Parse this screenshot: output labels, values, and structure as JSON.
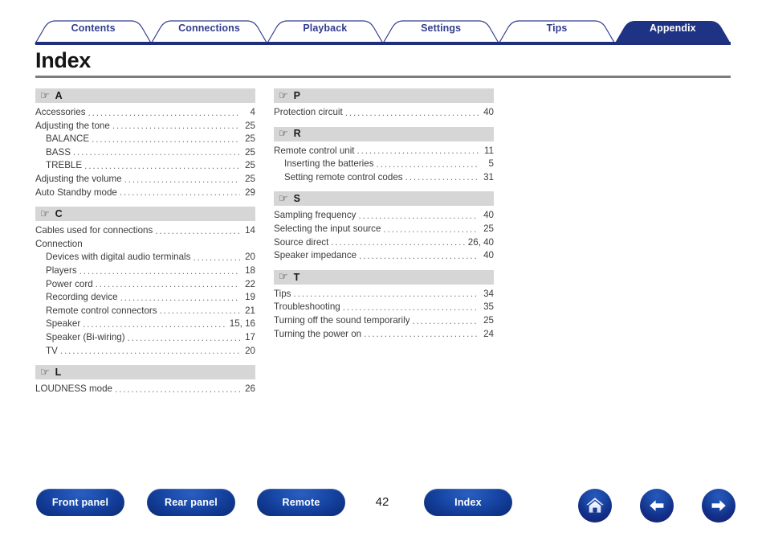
{
  "tabs": [
    {
      "label": "Contents",
      "active": false
    },
    {
      "label": "Connections",
      "active": false
    },
    {
      "label": "Playback",
      "active": false
    },
    {
      "label": "Settings",
      "active": false
    },
    {
      "label": "Tips",
      "active": false
    },
    {
      "label": "Appendix",
      "active": true
    }
  ],
  "page": {
    "title": "Index",
    "number": "42"
  },
  "colors": {
    "tab_border": "#313e8f",
    "tab_active_fill": "#1f3384",
    "tab_text": "#313e8f",
    "tab_active_text": "#ffffff",
    "rule_navy": "#1f2f7a",
    "rule_gray": "#7c7c7c",
    "section_band": "#d6d6d6",
    "entry_text": "#3c3c3c",
    "button_blue": "#14409b"
  },
  "section_icon": "pointing-hand-icon",
  "columns": {
    "left": [
      {
        "letter": "A",
        "entries": [
          {
            "text": "Accessories",
            "page": "4",
            "level": 0,
            "leader": true
          },
          {
            "text": "Adjusting the tone",
            "page": "25",
            "level": 0,
            "leader": true
          },
          {
            "text": "BALANCE",
            "page": "25",
            "level": 1,
            "leader": true
          },
          {
            "text": "BASS",
            "page": "25",
            "level": 1,
            "leader": true
          },
          {
            "text": "TREBLE",
            "page": "25",
            "level": 1,
            "leader": true
          },
          {
            "text": "Adjusting the volume",
            "page": "25",
            "level": 0,
            "leader": true
          },
          {
            "text": "Auto Standby mode",
            "page": "29",
            "level": 0,
            "leader": true
          }
        ]
      },
      {
        "letter": "C",
        "entries": [
          {
            "text": "Cables used for connections",
            "page": "14",
            "level": 0,
            "leader": true
          },
          {
            "text": "Connection",
            "page": "",
            "level": 0,
            "leader": false
          },
          {
            "text": "Devices with digital audio terminals",
            "page": "20",
            "level": 1,
            "leader": true
          },
          {
            "text": "Players",
            "page": "18",
            "level": 1,
            "leader": true
          },
          {
            "text": "Power cord",
            "page": "22",
            "level": 1,
            "leader": true
          },
          {
            "text": "Recording device",
            "page": "19",
            "level": 1,
            "leader": true
          },
          {
            "text": "Remote control connectors",
            "page": "21",
            "level": 1,
            "leader": true
          },
          {
            "text": "Speaker",
            "page": "15, 16",
            "level": 1,
            "leader": true
          },
          {
            "text": "Speaker (Bi-wiring)",
            "page": "17",
            "level": 1,
            "leader": true
          },
          {
            "text": "TV",
            "page": "20",
            "level": 1,
            "leader": true
          }
        ]
      },
      {
        "letter": "L",
        "entries": [
          {
            "text": "LOUDNESS mode",
            "page": "26",
            "level": 0,
            "leader": true
          }
        ]
      }
    ],
    "right": [
      {
        "letter": "P",
        "entries": [
          {
            "text": "Protection circuit",
            "page": "40",
            "level": 0,
            "leader": true
          }
        ]
      },
      {
        "letter": "R",
        "entries": [
          {
            "text": "Remote control unit",
            "page": "11",
            "level": 0,
            "leader": true
          },
          {
            "text": "Inserting the batteries",
            "page": "5",
            "level": 1,
            "leader": true
          },
          {
            "text": "Setting remote control codes",
            "page": "31",
            "level": 1,
            "leader": true
          }
        ]
      },
      {
        "letter": "S",
        "entries": [
          {
            "text": "Sampling frequency",
            "page": "40",
            "level": 0,
            "leader": true
          },
          {
            "text": "Selecting the input source",
            "page": "25",
            "level": 0,
            "leader": true
          },
          {
            "text": "Source direct",
            "page": "26, 40",
            "level": 0,
            "leader": true
          },
          {
            "text": "Speaker impedance",
            "page": "40",
            "level": 0,
            "leader": true
          }
        ]
      },
      {
        "letter": "T",
        "entries": [
          {
            "text": "Tips",
            "page": "34",
            "level": 0,
            "leader": true
          },
          {
            "text": "Troubleshooting",
            "page": "35",
            "level": 0,
            "leader": true
          },
          {
            "text": "Turning off the sound temporarily",
            "page": "25",
            "level": 0,
            "leader": true
          },
          {
            "text": "Turning the power on",
            "page": "24",
            "level": 0,
            "leader": true
          }
        ]
      }
    ]
  },
  "footer": {
    "buttons": [
      {
        "label": "Front panel"
      },
      {
        "label": "Rear panel"
      },
      {
        "label": "Remote"
      },
      {
        "label": "Index"
      }
    ],
    "nav_icons": [
      {
        "name": "home-icon"
      },
      {
        "name": "arrow-left-icon"
      },
      {
        "name": "arrow-right-icon"
      }
    ]
  }
}
